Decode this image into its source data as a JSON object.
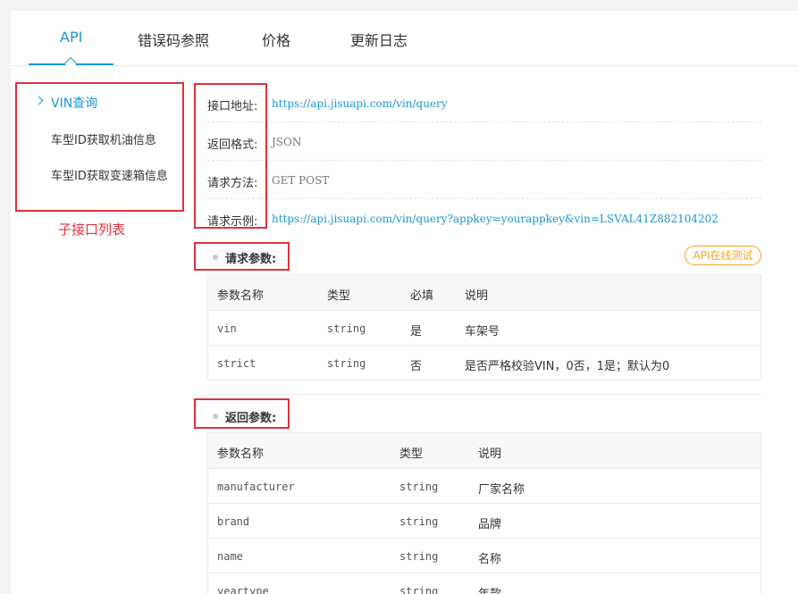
{
  "tabs": [
    {
      "label": "API",
      "active": true
    },
    {
      "label": "错误码参照",
      "active": false
    },
    {
      "label": "价格",
      "active": false
    },
    {
      "label": "更新日志",
      "active": false
    }
  ],
  "sidebar": {
    "items": [
      {
        "label": "VIN查询",
        "active": true
      },
      {
        "label": "车型ID获取机油信息",
        "active": false
      },
      {
        "label": "车型ID获取变速箱信息",
        "active": false
      }
    ],
    "annotation": "子接口列表"
  },
  "info": [
    {
      "label": "接口地址:",
      "value": "https://api.jisuapi.com/vin/query",
      "style": "link"
    },
    {
      "label": "返回格式:",
      "value": "JSON",
      "style": "plain"
    },
    {
      "label": "请求方法:",
      "value": "GET POST",
      "style": "plain"
    },
    {
      "label": "请求示例:",
      "value": "https://api.jisuapi.com/vin/query?appkey=yourappkey&vin=LSVAL41Z882104202",
      "style": "link"
    }
  ],
  "request_params": {
    "title": "请求参数:",
    "online_test": "API在线测试",
    "headers": [
      "参数名称",
      "类型",
      "必填",
      "说明"
    ],
    "rows": [
      [
        "vin",
        "string",
        "是",
        "车架号"
      ],
      [
        "strict",
        "string",
        "否",
        "是否严格校验VIN，0否，1是；默认为0"
      ]
    ]
  },
  "response_params": {
    "title": "返回参数:",
    "headers": [
      "参数名称",
      "类型",
      "说明"
    ],
    "rows": [
      [
        "manufacturer",
        "string",
        "厂家名称"
      ],
      [
        "brand",
        "string",
        "品牌"
      ],
      [
        "name",
        "string",
        "名称"
      ],
      [
        "yeartype",
        "string",
        "年款"
      ]
    ]
  },
  "colors": {
    "accent": "#1a97d6",
    "annotation": "#e0313a",
    "button": "#f5a623"
  }
}
